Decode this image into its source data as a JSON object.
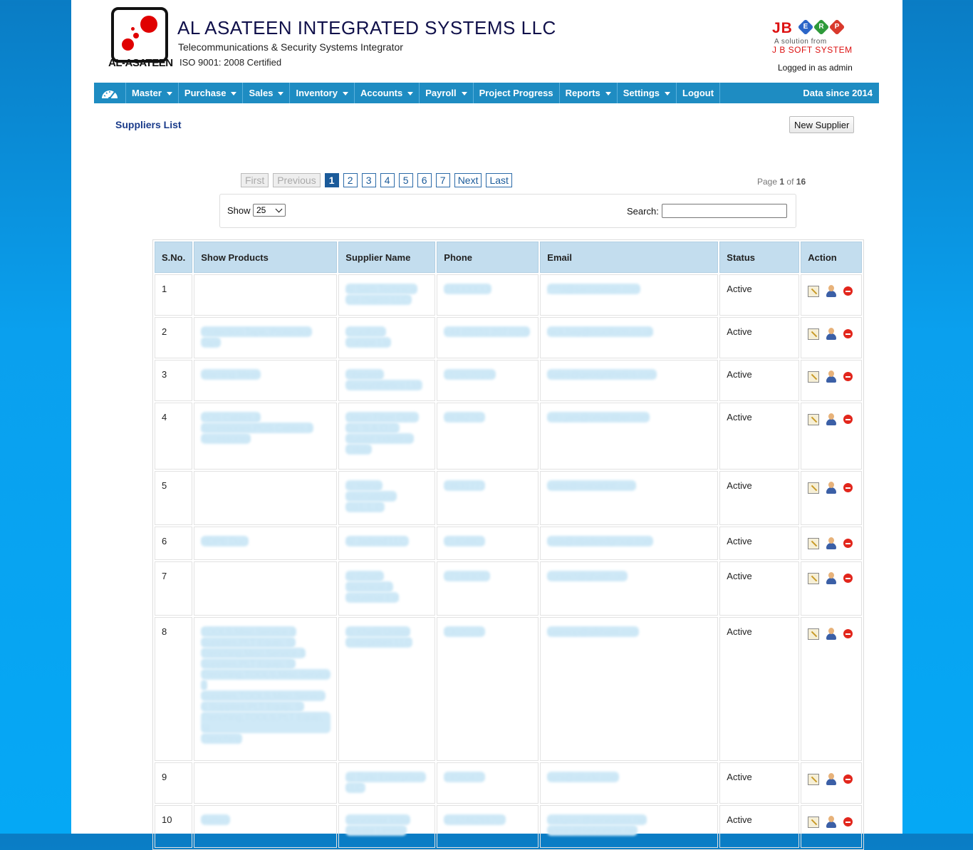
{
  "header": {
    "logo_text": "AL-ASATEEN",
    "company_name": "AL ASATEEN INTEGRATED SYSTEMS LLC",
    "tagline": "Telecommunications & Security Systems Integrator",
    "certification": "ISO 9001: 2008 Certified",
    "vendor": {
      "jb": "JB",
      "erp_letters": [
        "E",
        "R",
        "P"
      ],
      "solution_from": "A solution from",
      "system_name": "J B SOFT SYSTEM"
    },
    "logged_in": "Logged in as admin"
  },
  "nav": {
    "items": [
      {
        "label": "Master",
        "dropdown": true
      },
      {
        "label": "Purchase",
        "dropdown": true
      },
      {
        "label": "Sales",
        "dropdown": true
      },
      {
        "label": "Inventory",
        "dropdown": true
      },
      {
        "label": "Accounts",
        "dropdown": true
      },
      {
        "label": "Payroll",
        "dropdown": true
      },
      {
        "label": "Project Progress",
        "dropdown": false
      },
      {
        "label": "Reports",
        "dropdown": true
      },
      {
        "label": "Settings",
        "dropdown": true
      },
      {
        "label": "Logout",
        "dropdown": false
      }
    ],
    "data_since": "Data since 2014"
  },
  "page": {
    "title": "Suppliers List",
    "new_button": "New Supplier"
  },
  "pagination": {
    "first": "First",
    "previous": "Previous",
    "pages": [
      "1",
      "2",
      "3",
      "4",
      "5",
      "6",
      "7"
    ],
    "active_page": "1",
    "next": "Next",
    "last": "Last",
    "info_prefix": "Page",
    "current": "1",
    "info_of": "of",
    "total": "16"
  },
  "filter": {
    "show_label": "Show",
    "show_value": "25",
    "search_label": "Search:",
    "search_value": ""
  },
  "table": {
    "columns": [
      "S.No.",
      "Show Products",
      "Supplier Name",
      "Phone",
      "Email",
      "Status",
      "Action"
    ],
    "rows": [
      {
        "sno": "1",
        "products": [],
        "supplier": [
          "Al Sarh Technical",
          "Est (Sarco LLC)"
        ],
        "phone": [
          "24XXXXXX"
        ],
        "email": [
          "j***d@sarcooman.com"
        ],
        "status": "Active",
        "height": 58
      },
      {
        "sno": "2",
        "products": [
          "Protection Tape, Protection",
          "Tape"
        ],
        "supplier": [
          "Cruciform",
          "Europe Ltd"
        ],
        "phone": [
          "+44 (0)151 207 0109"
        ],
        "email": [
          "nick.hay@cruciform.co.uk"
        ],
        "status": "Active",
        "height": 58
      },
      {
        "sno": "3",
        "products": [
          "Warning Mesh"
        ],
        "supplier": [
          "Fiberweb",
          "Geosynthetics Ltd,"
        ],
        "phone": [
          "1516070109"
        ],
        "email": [
          "Sales@geosynthetics.com"
        ],
        "status": "Active",
        "height": 58
      },
      {
        "sno": "4",
        "products": [
          "POS Cables &",
          "Accessories,POS Cables &",
          "Accessories"
        ],
        "supplier": [
          "Oman Fiber Optic",
          "Co. S.A.O.G.",
          "Rusayl Industrial",
          "Estate"
        ],
        "phone": [
          "99382762"
        ],
        "email": [
          "info.jam@omanfiber.com"
        ],
        "status": "Active",
        "height": 94
      },
      {
        "sno": "5",
        "products": [],
        "supplier": [
          "Al Manar",
          "International",
          "Co.L.L.C."
        ],
        "phone": [
          "24631771"
        ],
        "email": [
          "sales@manarintl.com"
        ],
        "status": "Active",
        "height": 76
      },
      {
        "sno": "6",
        "products": [
          "HDPE Duct"
        ],
        "supplier": [
          "Al Jadeed LLC."
        ],
        "phone": [
          "91404801"
        ],
        "email": [
          "bala@aljadeedgroup.com"
        ],
        "status": "Active",
        "height": 47
      },
      {
        "sno": "7",
        "products": [],
        "supplier": [
          "Al Ghaith",
          "Technical &",
          "Industrial Est"
        ],
        "phone": [
          "071483093"
        ],
        "email": [
          "contact@ghaith.om"
        ],
        "status": "Active",
        "height": 76
      },
      {
        "sno": "8",
        "products": [
          "TOOLS,Misc.Service &",
          "Supplies,PLT Equip, SI",
          "Trenching,Misc.Service &",
          "Supplies,PLT Equip, SI",
          "Trenching,TOOLS,Misc.Service",
          "&",
          "Supplies,TOOLS,Misc.Service",
          "& Supplies,PLT Equip, SI",
          "Trenching,TOOLS,PLT Equip, SI",
          "Trenching"
        ],
        "supplier": [
          "Al Khalili United",
          "Enterprises LLC"
        ],
        "phone": [
          "23020100"
        ],
        "email": [
          "salesop@alkhalili.com"
        ],
        "status": "Active",
        "height": 202
      },
      {
        "sno": "9",
        "products": [],
        "supplier": [
          "Al Turki Enterprises",
          "LLC."
        ],
        "phone": [
          "24560470"
        ],
        "email": [
          "fami@alturki.com"
        ],
        "status": "Active",
        "height": 58
      },
      {
        "sno": "10",
        "products": [
          "Battery"
        ],
        "supplier": [
          "Servomax India",
          "Private Limited"
        ],
        "phone": [
          "919246269707"
        ],
        "email": [
          "mktgsec@servomax.net",
          "admin@servomax.net"
        ],
        "status": "Active",
        "height": 60
      }
    ]
  },
  "icons": {
    "home": "speedometer-icon",
    "edit": "edit-icon",
    "user": "user-icon",
    "delete": "delete-icon"
  },
  "colors": {
    "nav_bg": "#1e8cc2",
    "header_row": "#c3ddee",
    "title": "#1a3b8a",
    "brand_red": "#e00000"
  }
}
